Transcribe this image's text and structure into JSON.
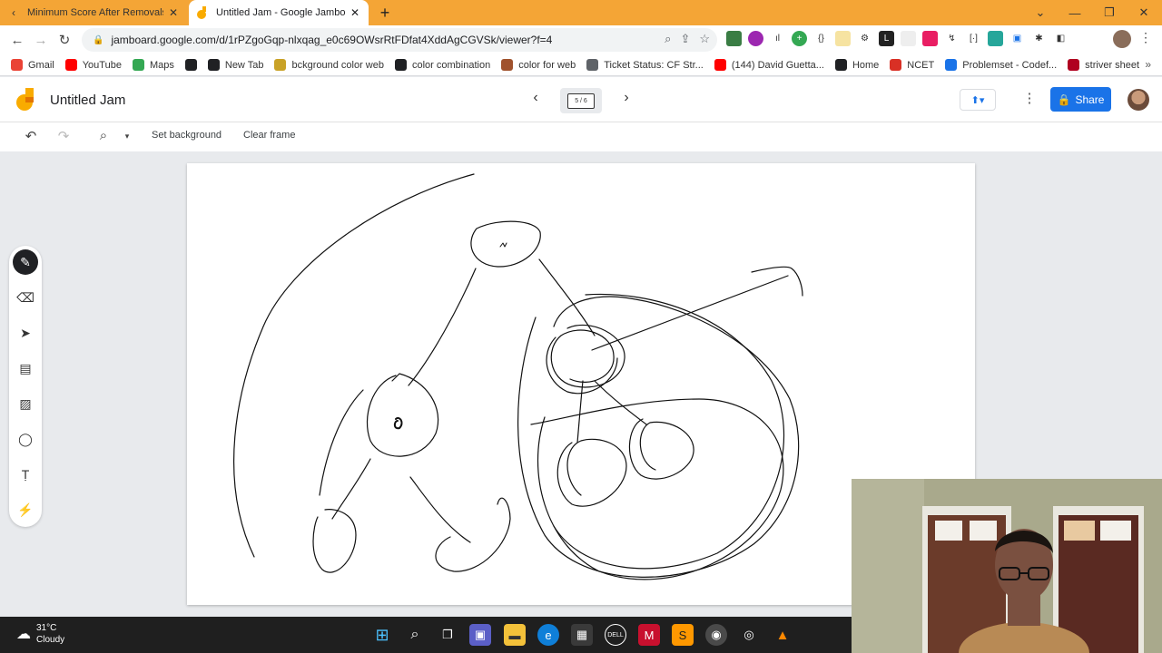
{
  "browser": {
    "tabs": [
      {
        "title": "Minimum Score After Removals o",
        "active": false
      },
      {
        "title": "Untitled Jam - Google Jamboard",
        "active": true
      }
    ],
    "url": "jamboard.google.com/d/1rPZgoGqp-nlxqag_e0c69OWsrRtFDfat4XddAgCGVSk/viewer?f=4",
    "bookmarks": [
      {
        "label": "Gmail",
        "color": "#ea4335"
      },
      {
        "label": "YouTube",
        "color": "#ff0000"
      },
      {
        "label": "Maps",
        "color": "#34a853"
      },
      {
        "label": "",
        "color": "#202124"
      },
      {
        "label": "New Tab",
        "color": "#202124"
      },
      {
        "label": "bckground color web",
        "color": "#c9a227"
      },
      {
        "label": "color combination",
        "color": "#202124"
      },
      {
        "label": "color for web",
        "color": "#a0522d"
      },
      {
        "label": "Ticket Status: CF Str...",
        "color": "#5f6368"
      },
      {
        "label": "(144) David Guetta...",
        "color": "#ff0000"
      },
      {
        "label": "Home",
        "color": "#202124"
      },
      {
        "label": "NCET",
        "color": "#d93025"
      },
      {
        "label": "Problemset - Codef...",
        "color": "#1a73e8"
      },
      {
        "label": "striver sheet",
        "color": "#b00020"
      }
    ]
  },
  "jamboard": {
    "title": "Untitled Jam",
    "frame_indicator": "5 / 6",
    "share_label": "Share",
    "actions": {
      "set_background": "Set background",
      "clear_frame": "Clear frame"
    }
  },
  "taskbar": {
    "temperature": "31°C",
    "condition": "Cloudy"
  }
}
